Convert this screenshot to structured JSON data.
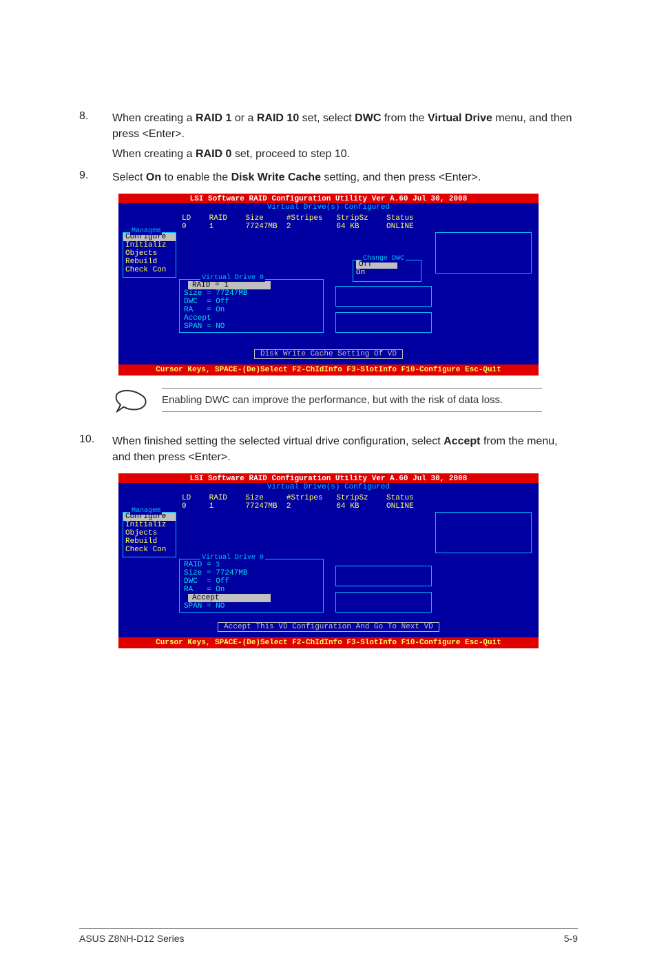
{
  "steps": {
    "s8": {
      "num": "8.",
      "body_pre": "When creating a ",
      "b1": "RAID 1",
      "mid1": " or a ",
      "b2": "RAID 10",
      "mid2": " set, select ",
      "b3": "DWC",
      "mid3": " from the ",
      "b4": "Virtual Drive",
      "mid4": " menu, and then press <Enter>.",
      "sub_pre": "When creating a ",
      "sub_b": "RAID 0",
      "sub_post": " set, proceed to step 10."
    },
    "s9": {
      "num": "9.",
      "pre": "Select ",
      "b1": "On",
      "mid1": " to enable the ",
      "b2": "Disk Write Cache",
      "post": " setting, and then press <Enter>."
    },
    "s10": {
      "num": "10.",
      "pre": "When finished setting the selected virtual drive configuration, select ",
      "b1": "Accept",
      "post": " from the menu, and then press <Enter>."
    }
  },
  "note": "Enabling DWC can improve the performance, but with the risk of data loss.",
  "bios": {
    "title": "LSI Software RAID Configuration Utility Ver A.60 Jul 30, 2008",
    "subtitle": "Virtual Drive(s) Configured",
    "header": "LD    RAID    Size     #Stripes   StripSz    Status",
    "datarow": "0     1       77247MB  2          64 KB      ONLINE",
    "sidebar_title": "Managem",
    "sidebar": [
      "Configure",
      "Initializ",
      "Objects",
      "Rebuild",
      "Check Con"
    ],
    "vd_title": "Virtual Drive 0",
    "vd_lines": [
      "RAID = 1",
      "Size = 77247MB",
      "DWC  = Off",
      "RA   = On",
      "Accept",
      "SPAN = NO"
    ],
    "change_title": "Change DWC",
    "change_items": [
      "Off",
      "On"
    ],
    "status1": "Disk Write Cache Setting Of VD",
    "status2": "Accept This VD Configuration And Go To Next VD",
    "footer": "Cursor Keys, SPACE-(De)Select F2-ChIdInfo F3-SlotInfo F10-Configure Esc-Quit"
  },
  "page_footer": {
    "left": "ASUS Z8NH-D12 Series",
    "right": "5-9"
  }
}
